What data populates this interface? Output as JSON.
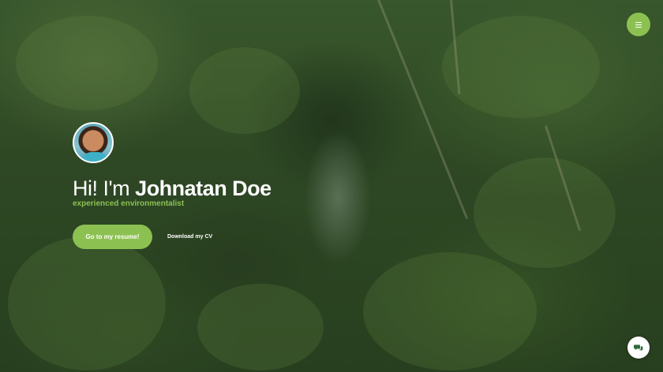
{
  "hero": {
    "greeting_prefix": "Hi! I'm",
    "name": "Johnatan Doe",
    "subtitle": "experienced environmentalist"
  },
  "actions": {
    "resume_label": "Go to my resume!",
    "download_label": "Download my CV"
  },
  "icons": {
    "menu": "hamburger-menu-icon",
    "chat": "chat-bubbles-icon"
  },
  "colors": {
    "accent": "#8cc152",
    "text": "#ffffff"
  }
}
